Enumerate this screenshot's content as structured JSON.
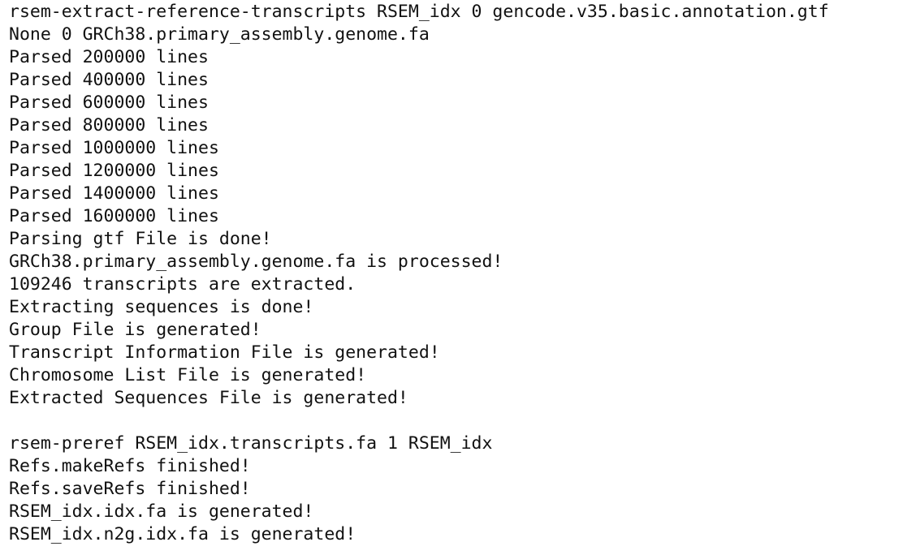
{
  "terminal": {
    "lines": [
      "rsem-extract-reference-transcripts RSEM_idx 0 gencode.v35.basic.annotation.gtf",
      "None 0 GRCh38.primary_assembly.genome.fa",
      "Parsed 200000 lines",
      "Parsed 400000 lines",
      "Parsed 600000 lines",
      "Parsed 800000 lines",
      "Parsed 1000000 lines",
      "Parsed 1200000 lines",
      "Parsed 1400000 lines",
      "Parsed 1600000 lines",
      "Parsing gtf File is done!",
      "GRCh38.primary_assembly.genome.fa is processed!",
      "109246 transcripts are extracted.",
      "Extracting sequences is done!",
      "Group File is generated!",
      "Transcript Information File is generated!",
      "Chromosome List File is generated!",
      "Extracted Sequences File is generated!",
      "",
      "rsem-preref RSEM_idx.transcripts.fa 1 RSEM_idx",
      "Refs.makeRefs finished!",
      "Refs.saveRefs finished!",
      "RSEM_idx.idx.fa is generated!",
      "RSEM_idx.n2g.idx.fa is generated!"
    ]
  }
}
